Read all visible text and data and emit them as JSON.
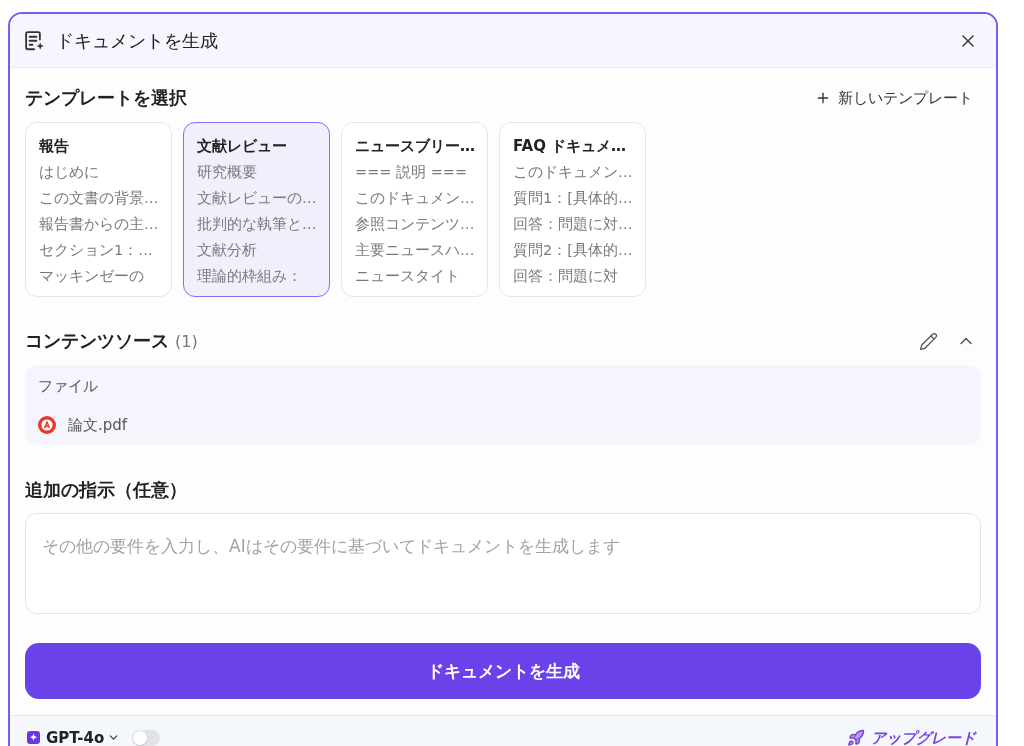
{
  "dialog": {
    "title": "ドキュメントを生成"
  },
  "templates": {
    "heading": "テンプレートを選択",
    "new_button": "新しいテンプレート",
    "items": [
      {
        "title": "報告",
        "selected": false,
        "lines": [
          "はじめに",
          "この文書の背景…",
          "報告書からの主…",
          "セクション1：…",
          "マッキンゼーの"
        ]
      },
      {
        "title": "文献レビュー",
        "selected": true,
        "lines": [
          "研究概要",
          "文献レビューの…",
          "批判的な執筆と…",
          "文献分析",
          "理論的枠組み："
        ]
      },
      {
        "title": "ニュースブリー…",
        "selected": false,
        "lines": [
          "=== 説明 ===",
          "このドキュメン…",
          "参照コンテンツ…",
          "主要ニュースハ…",
          "ニュースタイト"
        ]
      },
      {
        "title": "FAQ ドキュメ…",
        "selected": false,
        "lines": [
          "このドキュメン…",
          "質問1：[具体的…",
          "回答：問題に対…",
          "質問2：[具体的…",
          "回答：問題に対"
        ]
      }
    ]
  },
  "content_source": {
    "heading": "コンテンツソース",
    "count": "(1)",
    "expanded": true,
    "group_label": "ファイル",
    "files": [
      {
        "name": "論文.pdf"
      }
    ]
  },
  "instructions": {
    "heading": "追加の指示（任意）",
    "placeholder": "その他の要件を入力し、AIはその要件に基づいてドキュメントを生成します"
  },
  "generate_button": "ドキュメントを生成",
  "footer": {
    "model": "GPT-4o",
    "toggle": {
      "on": false
    },
    "upgrade": "アップグレード"
  }
}
